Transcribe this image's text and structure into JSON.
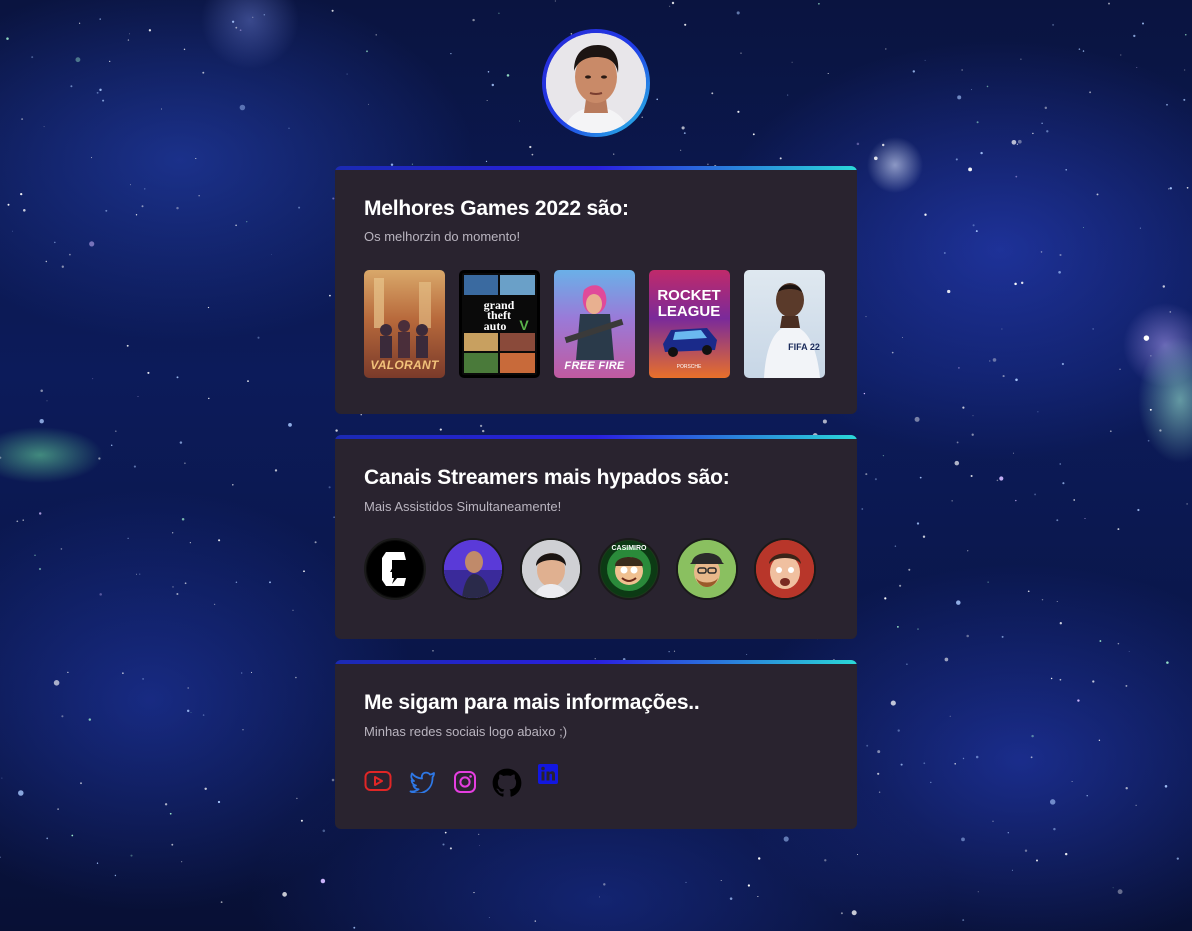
{
  "profile": {
    "avatar_alt": ""
  },
  "games_card": {
    "title": "Melhores Games 2022 são:",
    "subtitle": "Os melhorzin do momento!",
    "games": [
      {
        "name": "VALORANT",
        "icon": "valorant-cover"
      },
      {
        "name": "Grand Theft Auto V",
        "icon": "gta-v-cover"
      },
      {
        "name": "FREE FIRE",
        "icon": "free-fire-cover"
      },
      {
        "name": "ROCKET LEAGUE",
        "icon": "rocket-league-cover"
      },
      {
        "name": "FIFA 22",
        "icon": "fifa-22-cover"
      }
    ]
  },
  "streamers_card": {
    "title": "Canais Streamers mais hypados são:",
    "subtitle": "Mais Assistidos Simultaneamente!",
    "streamers": [
      {
        "icon": "streamer-logo-1"
      },
      {
        "icon": "streamer-avatar-2"
      },
      {
        "icon": "streamer-avatar-3"
      },
      {
        "icon": "casimiro-logo",
        "label": "CASIMIRO"
      },
      {
        "icon": "streamer-avatar-5"
      },
      {
        "icon": "streamer-avatar-6"
      }
    ]
  },
  "social_card": {
    "title": "Me sigam para mais informações..",
    "subtitle": "Minhas redes sociais logo abaixo ;)",
    "links": [
      {
        "icon": "youtube-icon",
        "color": "#e02626"
      },
      {
        "icon": "twitter-icon",
        "color": "#2e78e6"
      },
      {
        "icon": "instagram-icon",
        "color": "#e43ee0"
      },
      {
        "icon": "github-icon",
        "color": "#000000"
      },
      {
        "icon": "linkedin-icon",
        "color": "#1217e0"
      }
    ]
  },
  "colors": {
    "card_bg": "#29232f",
    "accent_gradient_start": "#1b2ab3",
    "accent_gradient_end": "#2ad8d8",
    "text_primary": "#ffffff",
    "text_secondary": "#b9b4bf"
  }
}
